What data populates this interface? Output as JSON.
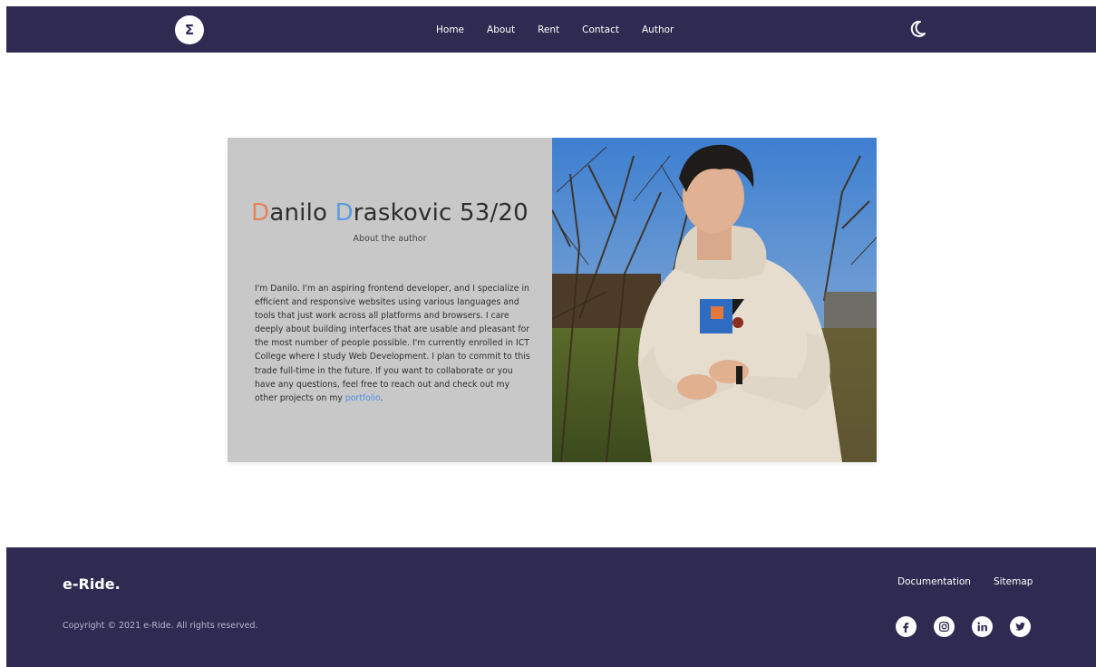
{
  "nav": {
    "logo_letter": "Σ",
    "links": [
      "Home",
      "About",
      "Rent",
      "Contact",
      "Author"
    ],
    "theme_icon": "moon-icon"
  },
  "author": {
    "name_first_initial": "D",
    "name_first_rest": "anilo ",
    "name_last_initial": "D",
    "name_last_rest": "raskovic 53/20",
    "subtitle": "About the author",
    "bio": "I'm Danilo. I'm an aspiring frontend developer, and I specialize in efficient and responsive websites using various languages and tools that just work across all platforms and browsers. I care deeply about building interfaces that are usable and pleasant for the most number of people possible. I'm currently enrolled in ICT College where I study Web Development. I plan to commit to this trade full-time in the future. If you want to collaborate or you have any questions, feel free to reach out and check out my other projects on my ",
    "bio_link": "portfolio",
    "bio_end": ".",
    "initial_colors": [
      "#e8815a",
      "#5b9ce0"
    ],
    "photo_icon": "author-photo"
  },
  "footer": {
    "brand": "e-Ride.",
    "copyright": "Copyright © 2021 e-Ride. All rights reserved.",
    "links": [
      "Documentation",
      "Sitemap"
    ],
    "socials": [
      "facebook-icon",
      "instagram-icon",
      "linkedin-icon",
      "twitter-icon"
    ]
  },
  "colors": {
    "nav_bg": "#2e2a52",
    "card_bg": "#c8c8c8",
    "link": "#4f8fe6"
  }
}
